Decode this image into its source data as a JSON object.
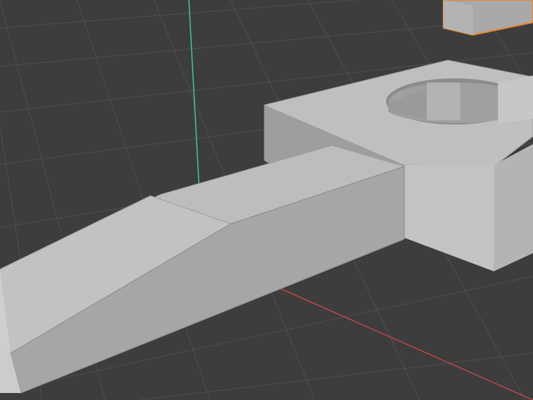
{
  "viewport": {
    "mode": "3d-viewport",
    "colors": {
      "background": "#3d3d3d",
      "grid_line": "#4f4f4f",
      "axis_x": "#d04848",
      "axis_y": "#3fcf86",
      "selection_outline": "#e7862a",
      "face_top": "#bdbdbd",
      "face_side": "#a9a9a9",
      "face_dark": "#8f8f8f",
      "edge": "#7a7a7a"
    },
    "objects": [
      {
        "name": "wrench-handle",
        "selected": false
      },
      {
        "name": "wrench-head-block",
        "selected": false
      },
      {
        "name": "selected-cube",
        "selected": true
      }
    ]
  }
}
